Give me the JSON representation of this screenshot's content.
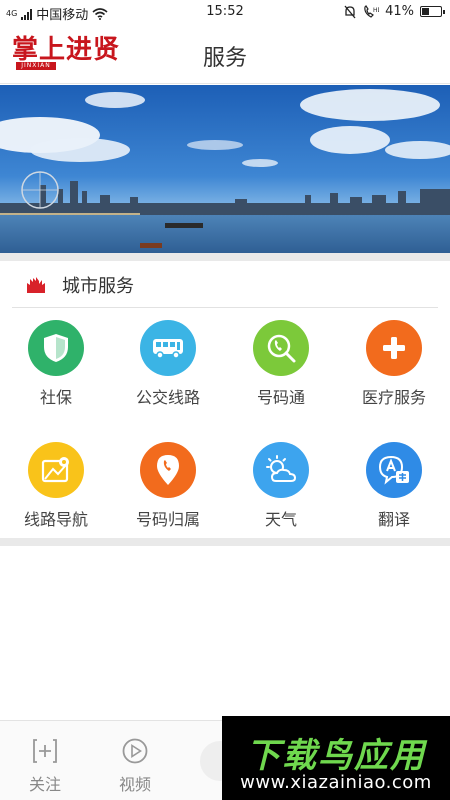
{
  "status_bar": {
    "network": "4G",
    "carrier": "中国移动",
    "time": "15:52",
    "battery": "41%",
    "battery_level": 0.41
  },
  "header": {
    "logo_text": "掌上进贤",
    "logo_sub": "JINXIAN",
    "title": "服务"
  },
  "section": {
    "title": "城市服务"
  },
  "services": [
    {
      "label": "社保",
      "icon": "shield-icon",
      "color": "#2fb26a"
    },
    {
      "label": "公交线路",
      "icon": "bus-icon",
      "color": "#3bb4e5"
    },
    {
      "label": "号码通",
      "icon": "phone-search-icon",
      "color": "#7cc93a"
    },
    {
      "label": "医疗服务",
      "icon": "medical-cross-icon",
      "color": "#f26b1d"
    },
    {
      "label": "线路导航",
      "icon": "map-navigation-icon",
      "color": "#f9c31a"
    },
    {
      "label": "号码归属",
      "icon": "phone-location-icon",
      "color": "#f26b1d"
    },
    {
      "label": "天气",
      "icon": "weather-icon",
      "color": "#3da4ee"
    },
    {
      "label": "翻译",
      "icon": "translate-icon",
      "color": "#2f8be6"
    }
  ],
  "bottom_nav": [
    {
      "label": "关注",
      "icon": "follow-plus-icon"
    },
    {
      "label": "视频",
      "icon": "video-play-icon"
    }
  ],
  "bottom_nav_center": "rec-button",
  "watermark": {
    "main": "下载鸟应用",
    "url": "www.xiazainiao.com"
  },
  "colors": {
    "brand_red": "#c8161d",
    "section_gray": "#e9e9e9"
  }
}
